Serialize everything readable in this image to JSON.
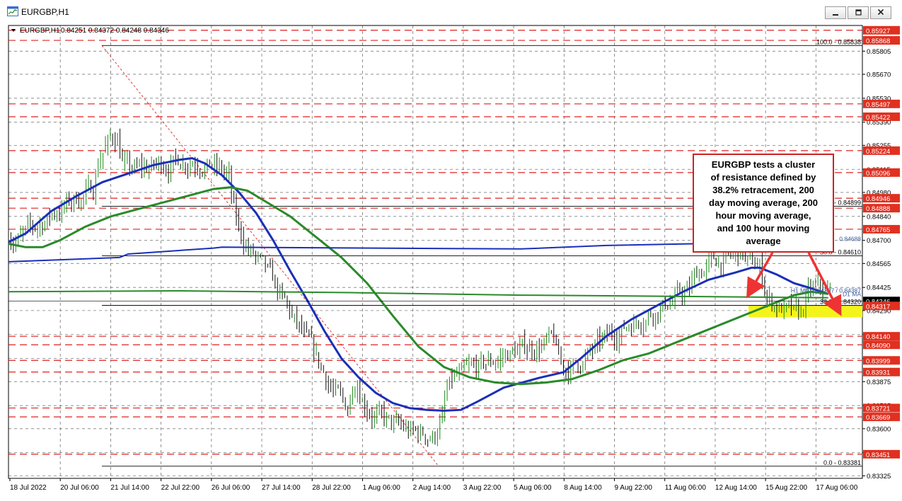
{
  "window": {
    "title": "EURGBP,H1",
    "buttons": [
      "minimize-icon",
      "restore-icon",
      "close-icon"
    ]
  },
  "colors": {
    "background": "#ffffff",
    "grid": "#000000",
    "bull_candle": "#1a8a1a",
    "bear_candle": "#111111",
    "ma_blue": "#1a2fb8",
    "ma_green": "#2a8a2a",
    "dashed_level": "#e02020",
    "price_tag": "#e03020",
    "callout_border": "#cc2222",
    "arrow": "#ee3333",
    "highlight_zone": "#f4f41c"
  },
  "chart_data": {
    "type": "candlestick",
    "symbol_label": "EURGBP,H1",
    "ohlc_header": "0.84251 0.84372 0.84248 0.84346",
    "ylim": [
      0.8331,
      0.85955
    ],
    "x_ticks": [
      "18 Jul 2022",
      "20 Jul 06:00",
      "21 Jul 14:00",
      "22 Jul 22:00",
      "26 Jul 06:00",
      "27 Jul 14:00",
      "28 Jul 22:00",
      "1 Aug 06:00",
      "2 Aug 14:00",
      "3 Aug 22:00",
      "5 Aug 06:00",
      "8 Aug 14:00",
      "9 Aug 22:00",
      "11 Aug 06:00",
      "12 Aug 14:00",
      "15 Aug 22:00",
      "17 Aug 06:00"
    ],
    "y_ticks": [
      0.85805,
      0.8567,
      0.8553,
      0.8539,
      0.85255,
      0.85115,
      0.8498,
      0.8484,
      0.847,
      0.84565,
      0.84425,
      0.8429,
      0.8415,
      0.8401,
      0.83875,
      0.83735,
      0.836,
      0.8346,
      0.83325
    ],
    "dashed_levels": [
      0.85927,
      0.85868,
      0.85497,
      0.85422,
      0.85224,
      0.85096,
      0.84946,
      0.84888,
      0.84765,
      0.8414,
      0.8409,
      0.83999,
      0.83931,
      0.83721,
      0.83669,
      0.83451
    ],
    "fibonacci": {
      "levels": [
        {
          "label": "100.0 - 0.85838",
          "value": 0.85838
        },
        {
          "label": "61.8 - 0.84899",
          "value": 0.84899
        },
        {
          "label": "50.0 - 0.84610",
          "value": 0.8461
        },
        {
          "label": "38.2 - 0.84320",
          "value": 0.8432
        },
        {
          "label": "0.0 - 0.83381",
          "value": 0.83381
        }
      ],
      "zone": [
        0.84251,
        0.8432
      ]
    },
    "ma_tags": [
      {
        "label": "0.84688",
        "value": 0.84688
      },
      {
        "label": "H1 MA: 0.84387 / 0.84387",
        "value": 0.84387
      },
      {
        "label": "D1 MA",
        "value": 0.84365
      }
    ],
    "current_price": {
      "value": 0.84346,
      "label": "0.84346"
    },
    "bid_tag": {
      "value": 0.84317,
      "label": "0.84317"
    },
    "series": [
      {
        "name": "100 hour moving average",
        "color": "#1a2fb8",
        "points": [
          [
            0,
            0.8469
          ],
          [
            0.02,
            0.8474
          ],
          [
            0.05,
            0.8487
          ],
          [
            0.08,
            0.8496
          ],
          [
            0.11,
            0.8504
          ],
          [
            0.14,
            0.8509
          ],
          [
            0.17,
            0.8514
          ],
          [
            0.2,
            0.8517
          ],
          [
            0.215,
            0.8518
          ],
          [
            0.23,
            0.8515
          ],
          [
            0.25,
            0.8508
          ],
          [
            0.27,
            0.8498
          ],
          [
            0.29,
            0.8486
          ],
          [
            0.31,
            0.847
          ],
          [
            0.33,
            0.8452
          ],
          [
            0.35,
            0.8435
          ],
          [
            0.37,
            0.8417
          ],
          [
            0.39,
            0.8401
          ],
          [
            0.41,
            0.839
          ],
          [
            0.43,
            0.8381
          ],
          [
            0.45,
            0.8375
          ],
          [
            0.47,
            0.8372
          ],
          [
            0.49,
            0.8371
          ],
          [
            0.51,
            0.83705
          ],
          [
            0.53,
            0.8371
          ],
          [
            0.55,
            0.8376
          ],
          [
            0.58,
            0.8384
          ],
          [
            0.62,
            0.83895
          ],
          [
            0.65,
            0.8393
          ],
          [
            0.67,
            0.8401
          ],
          [
            0.7,
            0.8414
          ],
          [
            0.73,
            0.8424
          ],
          [
            0.76,
            0.8432
          ],
          [
            0.79,
            0.844
          ],
          [
            0.82,
            0.8447
          ],
          [
            0.85,
            0.8451
          ],
          [
            0.87,
            0.8454
          ],
          [
            0.88,
            0.8454
          ],
          [
            0.9,
            0.845
          ],
          [
            0.92,
            0.8445
          ],
          [
            0.94,
            0.8442
          ],
          [
            0.96,
            0.84387
          ]
        ]
      },
      {
        "name": "100 hour moving average (green)",
        "color": "#2a8a2a",
        "points": [
          [
            0,
            0.8468
          ],
          [
            0.02,
            0.8466
          ],
          [
            0.04,
            0.8466
          ],
          [
            0.06,
            0.847
          ],
          [
            0.09,
            0.8478
          ],
          [
            0.12,
            0.8484
          ],
          [
            0.15,
            0.8488
          ],
          [
            0.18,
            0.8492
          ],
          [
            0.21,
            0.8496
          ],
          [
            0.24,
            0.85
          ],
          [
            0.26,
            0.8501
          ],
          [
            0.28,
            0.8499
          ],
          [
            0.3,
            0.8493
          ],
          [
            0.33,
            0.8484
          ],
          [
            0.36,
            0.8472
          ],
          [
            0.39,
            0.846
          ],
          [
            0.42,
            0.8445
          ],
          [
            0.45,
            0.8426
          ],
          [
            0.48,
            0.8408
          ],
          [
            0.51,
            0.8396
          ],
          [
            0.54,
            0.839
          ],
          [
            0.57,
            0.8387
          ],
          [
            0.6,
            0.8386
          ],
          [
            0.63,
            0.8387
          ],
          [
            0.66,
            0.8389
          ],
          [
            0.69,
            0.8394
          ],
          [
            0.72,
            0.84
          ],
          [
            0.75,
            0.8404
          ],
          [
            0.78,
            0.841
          ],
          [
            0.81,
            0.8416
          ],
          [
            0.84,
            0.8422
          ],
          [
            0.86,
            0.8426
          ],
          [
            0.88,
            0.843
          ],
          [
            0.9,
            0.8434
          ],
          [
            0.92,
            0.8438
          ],
          [
            0.94,
            0.844
          ],
          [
            0.96,
            0.84387
          ]
        ]
      },
      {
        "name": "200 hour moving average",
        "color": "#1a2fb8",
        "points": [
          [
            0,
            0.84575
          ],
          [
            0.13,
            0.846
          ],
          [
            0.14,
            0.8462
          ],
          [
            0.24,
            0.84655
          ],
          [
            0.25,
            0.8466
          ],
          [
            0.6,
            0.8465
          ],
          [
            0.7,
            0.8467
          ],
          [
            0.9,
            0.8469
          ],
          [
            0.935,
            0.84688
          ]
        ]
      },
      {
        "name": "200 day moving average",
        "color": "#2a8a2a",
        "points": [
          [
            0,
            0.844
          ],
          [
            0.2,
            0.84405
          ],
          [
            0.4,
            0.84395
          ],
          [
            0.6,
            0.8438
          ],
          [
            0.8,
            0.84372
          ],
          [
            0.96,
            0.84365
          ]
        ]
      }
    ],
    "annotation": "EURGBP tests a cluster of resistance defined by 38.2% retracement, 200 day moving average, 200 hour moving average, and 100 hour moving average"
  }
}
